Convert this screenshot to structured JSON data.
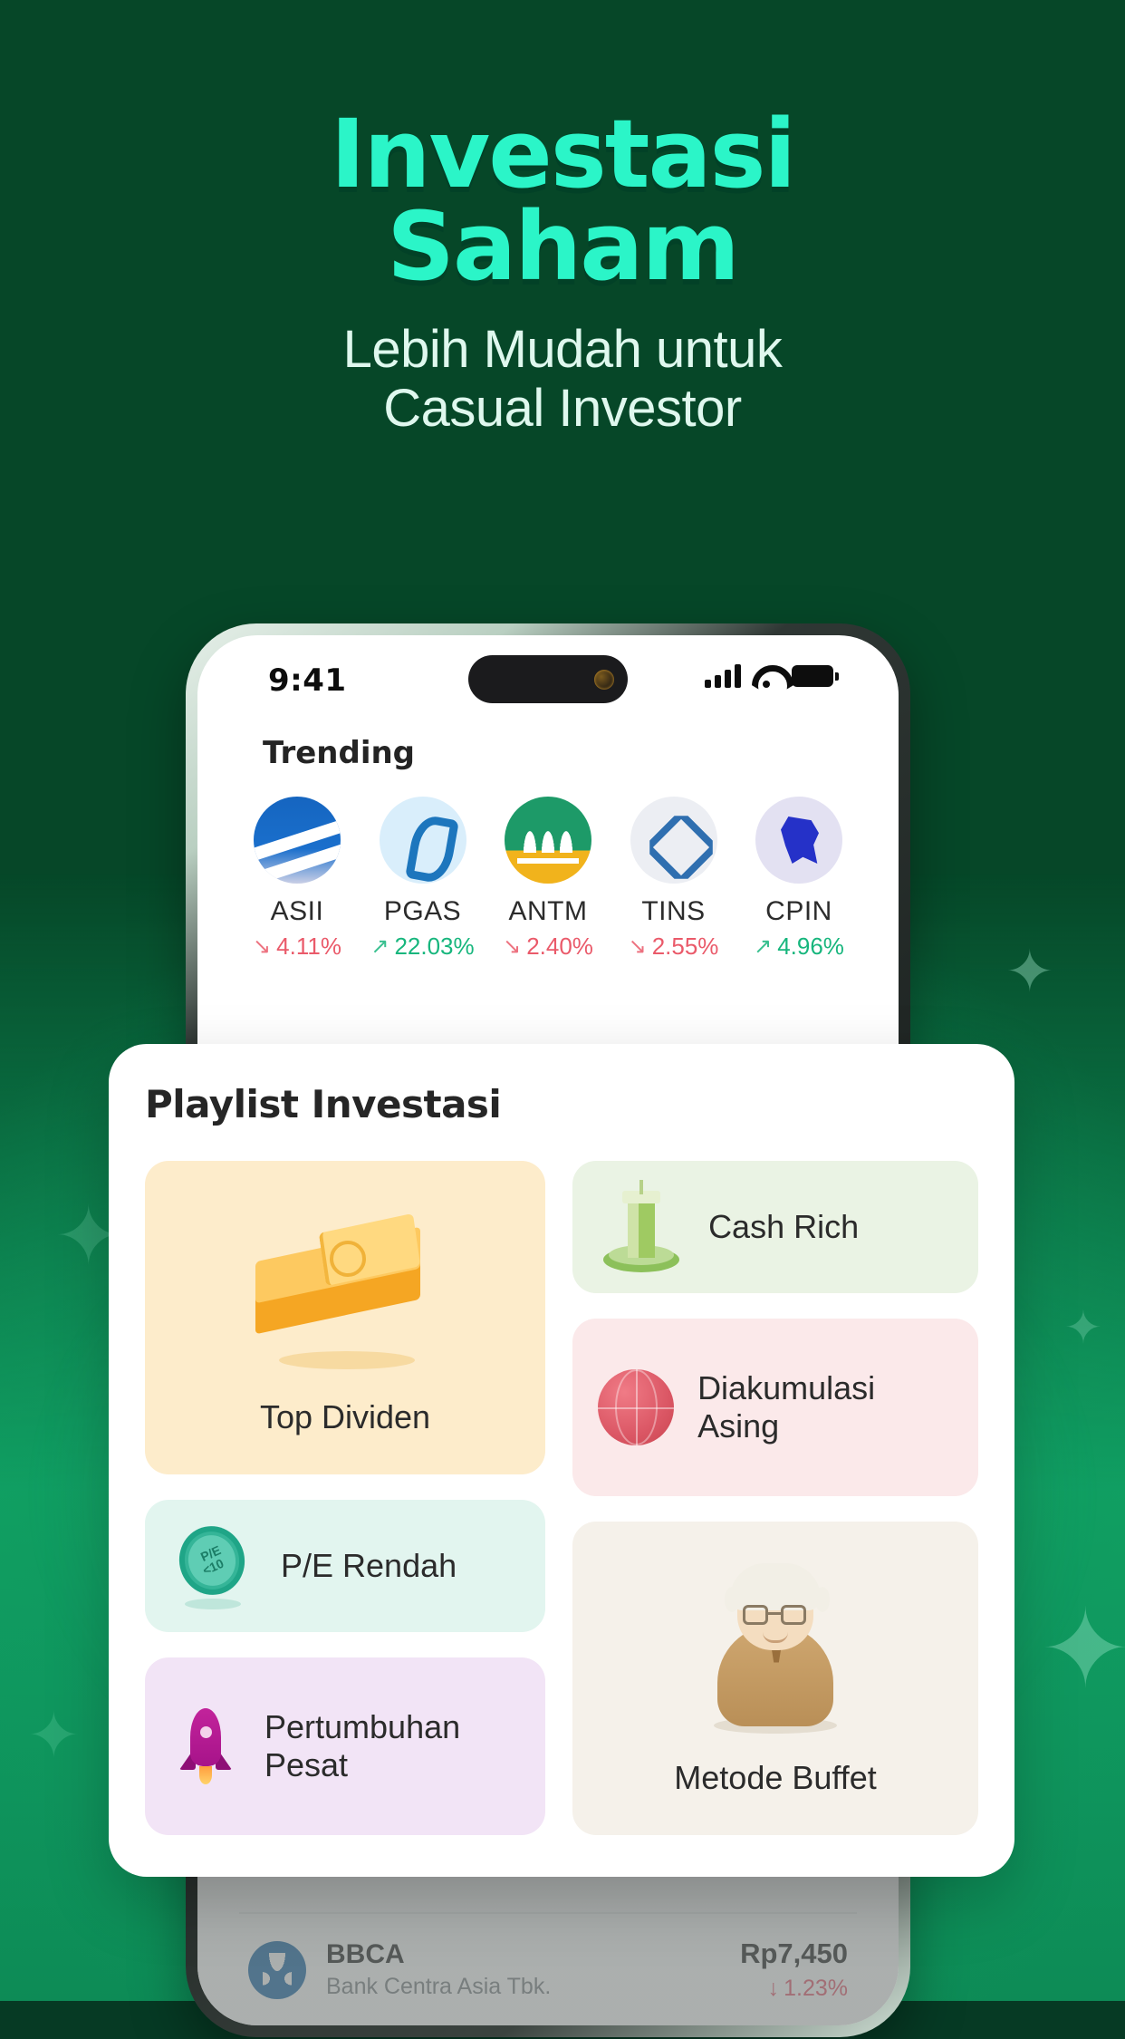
{
  "hero": {
    "headline_line1": "Investasi",
    "headline_line2": "Saham",
    "subtitle_line1": "Lebih Mudah untuk",
    "subtitle_line2": "Casual Investor",
    "headline_color": "#2bf5c8",
    "subtitle_color": "#dff8ee",
    "background_color": "#064728"
  },
  "phone": {
    "status_bar": {
      "time": "9:41",
      "signal_icon": "cellular-bars-icon",
      "wifi_icon": "wifi-icon",
      "battery_icon": "battery-icon"
    },
    "trending": {
      "title": "Trending",
      "items": [
        {
          "code": "ASII",
          "change": "4.11%",
          "direction": "down",
          "arrow": "↘",
          "logo": "asii-logo-icon"
        },
        {
          "code": "PGAS",
          "change": "22.03%",
          "direction": "up",
          "arrow": "↗",
          "logo": "pgas-logo-icon"
        },
        {
          "code": "ANTM",
          "change": "2.40%",
          "direction": "down",
          "arrow": "↘",
          "logo": "antm-logo-icon"
        },
        {
          "code": "TINS",
          "change": "2.55%",
          "direction": "down",
          "arrow": "↘",
          "logo": "tins-logo-icon"
        },
        {
          "code": "CPIN",
          "change": "4.96%",
          "direction": "up",
          "arrow": "↗",
          "logo": "cpin-logo-icon"
        }
      ],
      "up_color": "#17b67d",
      "down_color": "#ea5a6a"
    },
    "stock_list": [
      {
        "code": "BBCA",
        "name": "Bank Centra Asia Tbk.",
        "price": "Rp7,450",
        "change": "1.23%",
        "arrow": "↓",
        "direction": "down",
        "logo": "bbca-logo-icon"
      }
    ]
  },
  "playlist": {
    "title": "Playlist Investasi",
    "tiles": [
      {
        "label": "Top Dividen",
        "art": "money-stack-icon",
        "bg": "#fdeccb",
        "layout": "big"
      },
      {
        "label": "Cash Rich",
        "art": "building-icon",
        "bg": "#eaf3e4",
        "layout": "wide"
      },
      {
        "label": "Diakumulasi Asing",
        "art": "globe-icon",
        "bg": "#fbe9ea",
        "layout": "wide"
      },
      {
        "label": "P/E Rendah",
        "art": "coin-icon",
        "bg": "#e2f5ef",
        "layout": "wide"
      },
      {
        "label": "Pertumbuhan Pesat",
        "art": "rocket-icon",
        "bg": "#f2e4f6",
        "layout": "wide"
      },
      {
        "label": "Metode Buffet",
        "art": "investor-icon",
        "bg": "#f5f1ea",
        "layout": "big"
      }
    ],
    "coin_badge_line1": "P/E",
    "coin_badge_line2": "<10"
  },
  "decorations": {
    "sparkle_glyph": "✦"
  }
}
